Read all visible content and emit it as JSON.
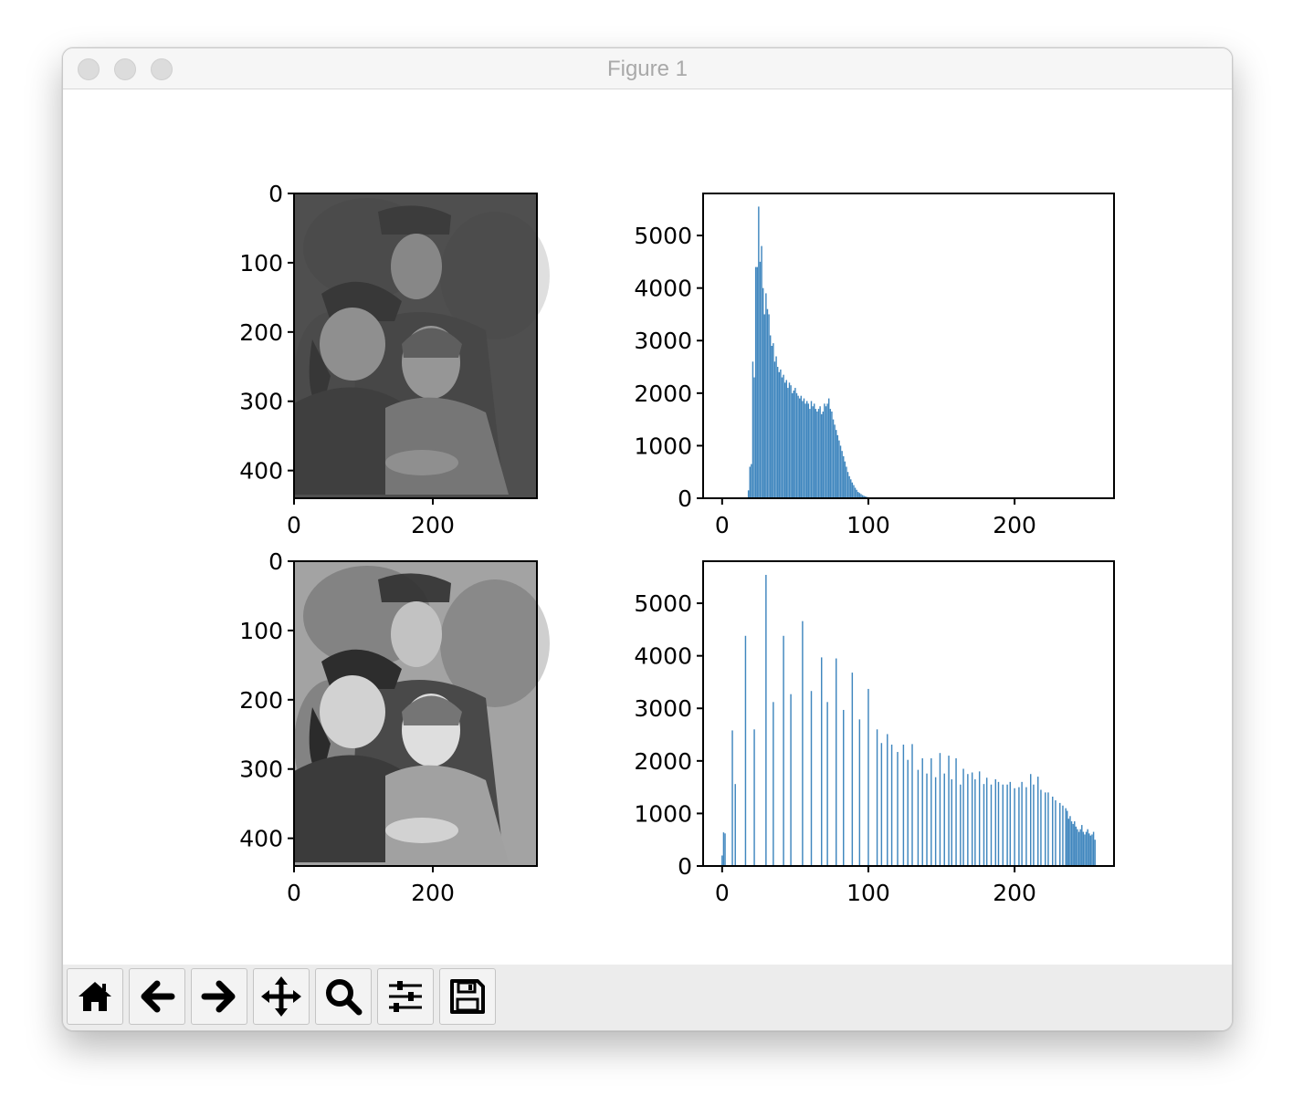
{
  "window": {
    "title": "Figure 1"
  },
  "toolbar": {
    "buttons": [
      {
        "icon": "home-icon",
        "name": "home-button"
      },
      {
        "icon": "back-arrow-icon",
        "name": "back-button"
      },
      {
        "icon": "forward-arrow-icon",
        "name": "forward-button"
      },
      {
        "icon": "pan-move-icon",
        "name": "pan-button"
      },
      {
        "icon": "zoom-magnifier-icon",
        "name": "zoom-button"
      },
      {
        "icon": "configure-subplots-icon",
        "name": "configure-subplots-button"
      },
      {
        "icon": "save-floppy-icon",
        "name": "save-button"
      }
    ]
  },
  "colors": {
    "bar": "#3f86be"
  },
  "images": [
    {
      "name": "original-photo",
      "description_shown": "grayscale family photograph, low contrast",
      "xticks": [
        "0",
        "200"
      ],
      "yticks": [
        "0",
        "100",
        "200",
        "300",
        "400"
      ]
    },
    {
      "name": "equalized-photo",
      "description_shown": "grayscale family photograph, high contrast",
      "xticks": [
        "0",
        "200"
      ],
      "yticks": [
        "0",
        "100",
        "200",
        "300",
        "400"
      ]
    }
  ],
  "chart_data": [
    {
      "type": "bar",
      "xlim": [
        -13,
        268
      ],
      "ylim": [
        0,
        5800
      ],
      "xticks": [
        "0",
        "100",
        "200"
      ],
      "yticks": [
        "0",
        "1000",
        "2000",
        "3000",
        "4000",
        "5000"
      ],
      "x": [
        18,
        19,
        20,
        21,
        22,
        23,
        24,
        25,
        26,
        27,
        28,
        29,
        30,
        31,
        32,
        33,
        34,
        35,
        36,
        37,
        38,
        39,
        40,
        41,
        42,
        43,
        44,
        45,
        46,
        47,
        48,
        49,
        50,
        51,
        52,
        53,
        54,
        55,
        56,
        57,
        58,
        59,
        60,
        61,
        62,
        63,
        64,
        65,
        66,
        67,
        68,
        69,
        70,
        71,
        72,
        73,
        74,
        75,
        76,
        77,
        78,
        79,
        80,
        81,
        82,
        83,
        84,
        85,
        86,
        87,
        88,
        89,
        90,
        91,
        92,
        93,
        94,
        95,
        96,
        97,
        98,
        99,
        100,
        101,
        102,
        103,
        104,
        105,
        106,
        107,
        108,
        109,
        110,
        111,
        112,
        113,
        114,
        115,
        116,
        117,
        118,
        119,
        120,
        121,
        122
      ],
      "values": [
        150,
        600,
        650,
        2600,
        2300,
        4400,
        4400,
        5550,
        4500,
        4800,
        4000,
        3500,
        3900,
        3600,
        3500,
        3100,
        2900,
        2950,
        2600,
        2700,
        2500,
        2400,
        2450,
        2300,
        2350,
        2200,
        2250,
        2100,
        2200,
        2150,
        2000,
        2050,
        2100,
        2000,
        1950,
        1900,
        1950,
        1850,
        1900,
        1800,
        1850,
        1800,
        1700,
        1850,
        1750,
        1800,
        1700,
        1650,
        1700,
        1750,
        1600,
        1650,
        1800,
        1750,
        1800,
        1900,
        1700,
        1650,
        1500,
        1400,
        1300,
        1200,
        1100,
        1000,
        900,
        800,
        700,
        600,
        500,
        420,
        360,
        300,
        250,
        200,
        160,
        120,
        100,
        80,
        60,
        45,
        35,
        25,
        20,
        15,
        12,
        10,
        8,
        6,
        5,
        4,
        3,
        3,
        2,
        2,
        2,
        1,
        1,
        1,
        1,
        1,
        1,
        1,
        1,
        1,
        1
      ]
    },
    {
      "type": "bar",
      "xlim": [
        -13,
        268
      ],
      "ylim": [
        0,
        5800
      ],
      "xticks": [
        "0",
        "100",
        "200"
      ],
      "yticks": [
        "0",
        "1000",
        "2000",
        "3000",
        "4000",
        "5000"
      ],
      "x": [
        0,
        1,
        2,
        7,
        9,
        16,
        22,
        30,
        35,
        42,
        47,
        55,
        61,
        68,
        72,
        78,
        83,
        89,
        94,
        100,
        106,
        109,
        113,
        116,
        120,
        124,
        127,
        130,
        134,
        137,
        140,
        143,
        146,
        149,
        152,
        155,
        157,
        160,
        163,
        165,
        168,
        171,
        173,
        176,
        179,
        181,
        184,
        187,
        189,
        192,
        195,
        197,
        200,
        203,
        205,
        208,
        211,
        213,
        216,
        218,
        221,
        223,
        226,
        228,
        231,
        233,
        235,
        236,
        237,
        238,
        239,
        240,
        241,
        242,
        243,
        244,
        245,
        246,
        247,
        248,
        249,
        250,
        251,
        252,
        253,
        254,
        255
      ],
      "values": [
        200,
        640,
        620,
        2580,
        1560,
        4380,
        2600,
        5540,
        3120,
        4380,
        3270,
        4660,
        3330,
        3970,
        3120,
        3950,
        2970,
        3680,
        2790,
        3370,
        2600,
        2340,
        2510,
        2310,
        2170,
        2310,
        2020,
        2320,
        1830,
        2050,
        1760,
        2050,
        1690,
        2150,
        1760,
        2100,
        1650,
        2050,
        1550,
        1850,
        1750,
        1780,
        1650,
        1800,
        1560,
        1680,
        1550,
        1650,
        1600,
        1550,
        1550,
        1600,
        1480,
        1500,
        1600,
        1500,
        1750,
        1550,
        1700,
        1450,
        1400,
        1400,
        1320,
        1250,
        1200,
        1150,
        1100,
        1050,
        900,
        950,
        850,
        800,
        850,
        750,
        700,
        650,
        700,
        780,
        650,
        600,
        650,
        700,
        620,
        580,
        600,
        650,
        500
      ]
    }
  ]
}
